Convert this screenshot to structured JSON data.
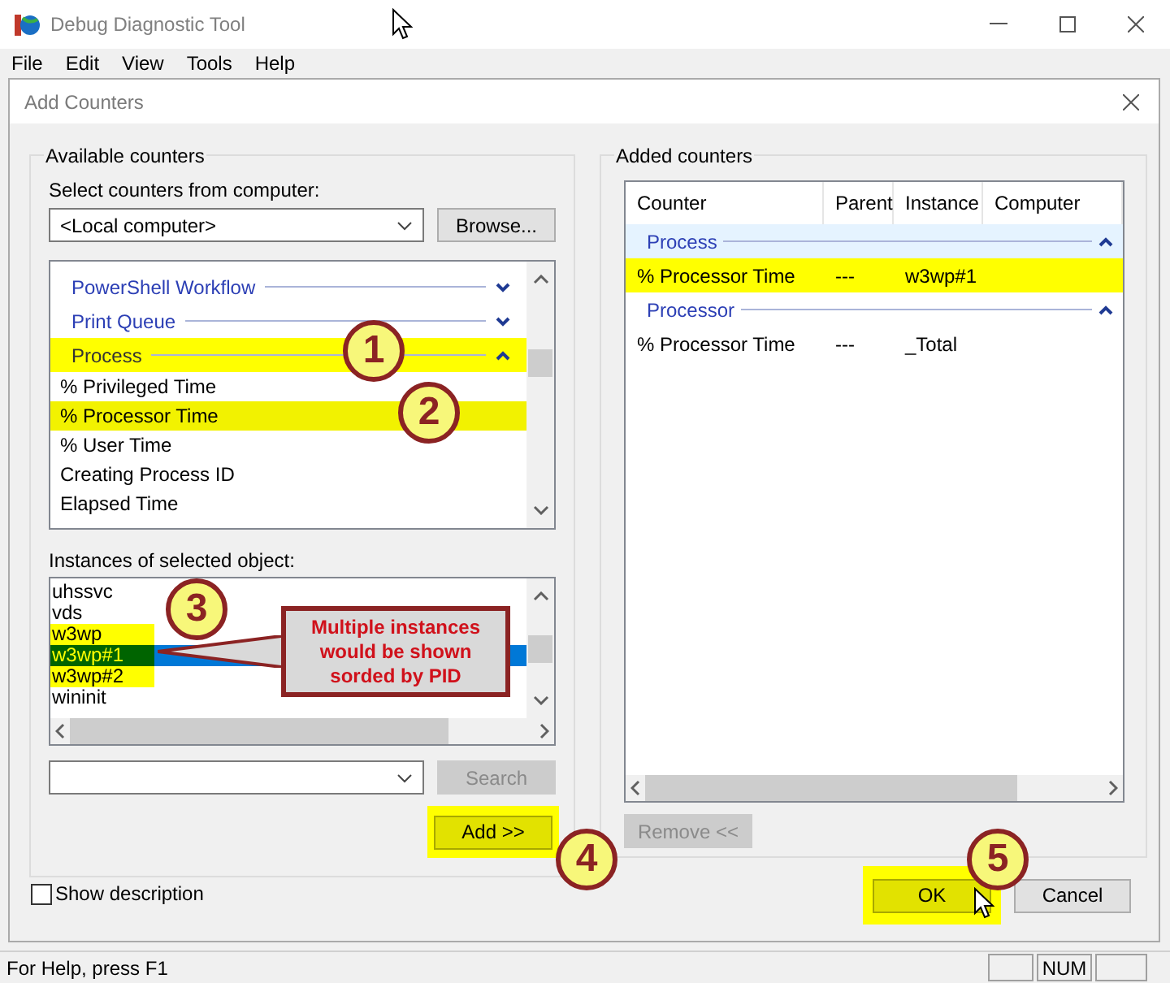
{
  "window": {
    "title": "Debug Diagnostic Tool",
    "menu": [
      "File",
      "Edit",
      "View",
      "Tools",
      "Help"
    ]
  },
  "dialog": {
    "title": "Add Counters"
  },
  "available_counters": {
    "title": "Available counters",
    "computer_label": "Select counters from computer:",
    "computer_value": "<Local computer>",
    "browse_button": "Browse...",
    "items": [
      {
        "kind": "category",
        "label": "PowerShell Workflow",
        "expanded": false,
        "highlighted": false
      },
      {
        "kind": "category",
        "label": "Print Queue",
        "expanded": false,
        "highlighted": false
      },
      {
        "kind": "category",
        "label": "Process",
        "expanded": true,
        "highlighted": true
      },
      {
        "kind": "counter",
        "label": "% Privileged Time",
        "highlighted": false
      },
      {
        "kind": "counter",
        "label": "% Processor Time",
        "highlighted": true
      },
      {
        "kind": "counter",
        "label": "% User Time",
        "highlighted": false
      },
      {
        "kind": "counter",
        "label": "Creating Process ID",
        "highlighted": false
      },
      {
        "kind": "counter",
        "label": "Elapsed Time",
        "highlighted": false
      }
    ]
  },
  "instances": {
    "label": "Instances of selected object:",
    "items": [
      {
        "label": "uhssvc",
        "highlighted": false,
        "selected": false
      },
      {
        "label": "vds",
        "highlighted": false,
        "selected": false
      },
      {
        "label": "w3wp",
        "highlighted": true,
        "selected": false
      },
      {
        "label": "w3wp#1",
        "highlighted": true,
        "selected": true
      },
      {
        "label": "w3wp#2",
        "highlighted": true,
        "selected": false
      },
      {
        "label": "wininit",
        "highlighted": false,
        "selected": false
      }
    ],
    "search_button": {
      "label": "Search",
      "disabled": true
    }
  },
  "add_button": {
    "label": "Add >>",
    "highlighted": true
  },
  "added_counters": {
    "title": "Added counters",
    "columns": [
      "Counter",
      "Parent",
      "Instance",
      "Computer"
    ],
    "rows": [
      {
        "kind": "group",
        "label": "Process",
        "selected": true
      },
      {
        "kind": "counter",
        "cells": [
          "% Processor Time",
          "---",
          "w3wp#1"
        ],
        "highlighted": true
      },
      {
        "kind": "group",
        "label": "Processor",
        "selected": false
      },
      {
        "kind": "counter",
        "cells": [
          "% Processor Time",
          "---",
          "_Total"
        ],
        "highlighted": false
      }
    ]
  },
  "remove_button": {
    "label": "Remove <<",
    "disabled": true
  },
  "show_description": {
    "label": "Show description",
    "checked": false
  },
  "ok_button": {
    "label": "OK",
    "highlighted": true
  },
  "cancel_button": {
    "label": "Cancel",
    "highlighted": false
  },
  "annotations": {
    "markers": [
      "1",
      "2",
      "3",
      "4",
      "5"
    ],
    "callout": "Multiple instances would be shown sorded by PID"
  },
  "status_bar": {
    "text": "For Help, press F1",
    "indicators": [
      "NUM"
    ]
  }
}
